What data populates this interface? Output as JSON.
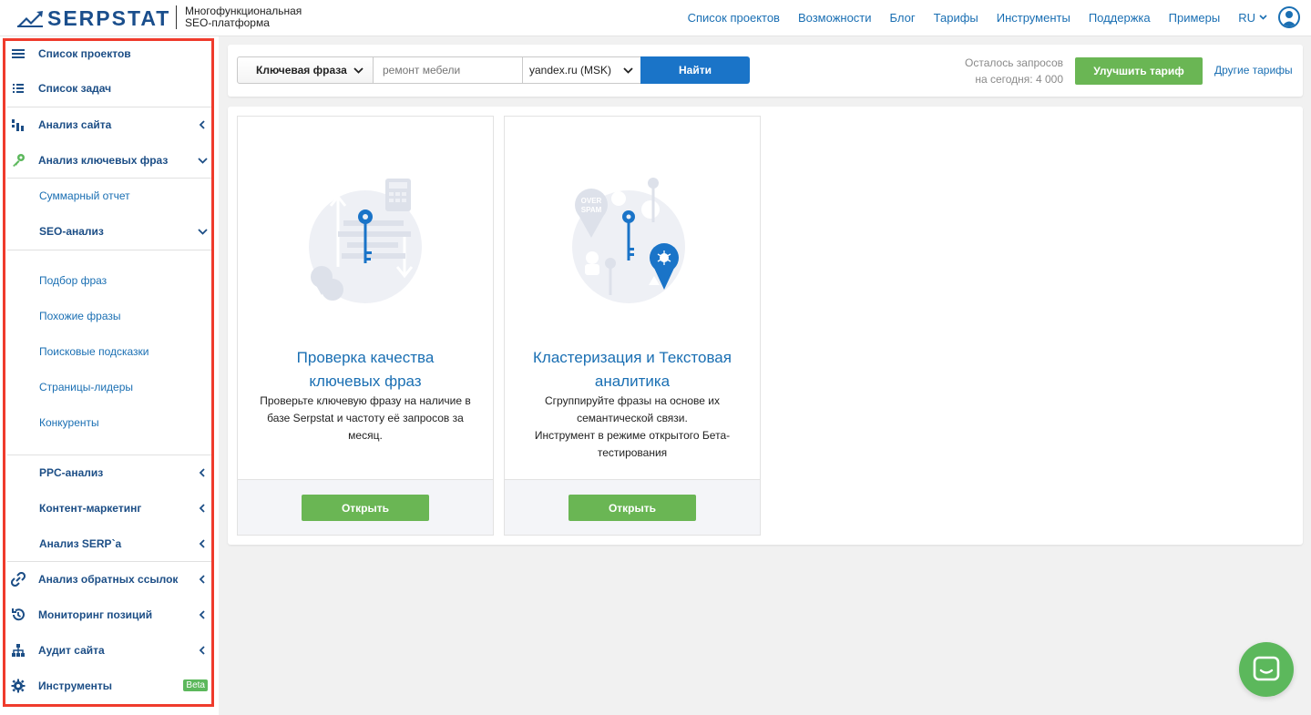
{
  "header": {
    "logo_text": "SERPSTAT",
    "tagline_line1": "Многофункциональная",
    "tagline_line2": "SEO-платформа",
    "nav": [
      "Список проектов",
      "Возможности",
      "Блог",
      "Тарифы",
      "Инструменты",
      "Поддержка",
      "Примеры"
    ],
    "language": "RU",
    "colors": {
      "brand": "#1a4e8c",
      "link": "#1a6fb3"
    }
  },
  "sidebar": {
    "items": [
      {
        "label": "Список проектов",
        "icon": "menu-icon"
      },
      {
        "label": "Список задач",
        "icon": "task-list-icon"
      },
      {
        "label": "Анализ сайта",
        "icon": "site-analysis-icon"
      },
      {
        "label": "Анализ ключевых фраз",
        "icon": "key-icon"
      },
      {
        "label": "Суммарный отчет"
      },
      {
        "label": "SEO-анализ"
      },
      {
        "label": "Подбор фраз"
      },
      {
        "label": "Похожие фразы"
      },
      {
        "label": "Поисковые подсказки"
      },
      {
        "label": "Страницы-лидеры"
      },
      {
        "label": "Конкуренты"
      },
      {
        "label": "PPC-анализ"
      },
      {
        "label": "Контент-маркетинг"
      },
      {
        "label": "Анализ SERP`а"
      },
      {
        "label": "Анализ обратных ссылок",
        "icon": "link-icon"
      },
      {
        "label": "Мониторинг позиций",
        "icon": "history-icon"
      },
      {
        "label": "Аудит сайта",
        "icon": "sitemap-icon"
      },
      {
        "label": "Инструменты",
        "icon": "gear-icon",
        "badge": "Beta"
      }
    ],
    "highlight_color": "#ef3b2c"
  },
  "search": {
    "type_label": "Ключевая фраза",
    "query_placeholder": "ремонт мебели",
    "database": "yandex.ru (MSK)",
    "find_label": "Найти",
    "quota_line1": "Осталось запросов",
    "quota_line2": "на сегодня: 4 000",
    "upgrade_label": "Улучшить тариф",
    "other_plans_label": "Другие тарифы"
  },
  "cards": [
    {
      "title_line1": "Проверка качества",
      "title_line2": "ключевых фраз",
      "desc_line1": "Проверьте ключевую фразу на наличие в",
      "desc_line2": "базе Serpstat и частоту её запросов за",
      "desc_line3": "месяц.",
      "button": "Открыть"
    },
    {
      "title_line1": "Кластеризация и Текстовая",
      "title_line2": "аналитика",
      "desc_line1": "Сгруппируйте фразы на основе их",
      "desc_line2": "семантической связи.",
      "desc_line3": "Инструмент в режиме открытого Бета-",
      "desc_line4": "тестирования",
      "button": "Открыть",
      "illustration_text_line1": "OVER",
      "illustration_text_line2": "SPAM"
    }
  ]
}
